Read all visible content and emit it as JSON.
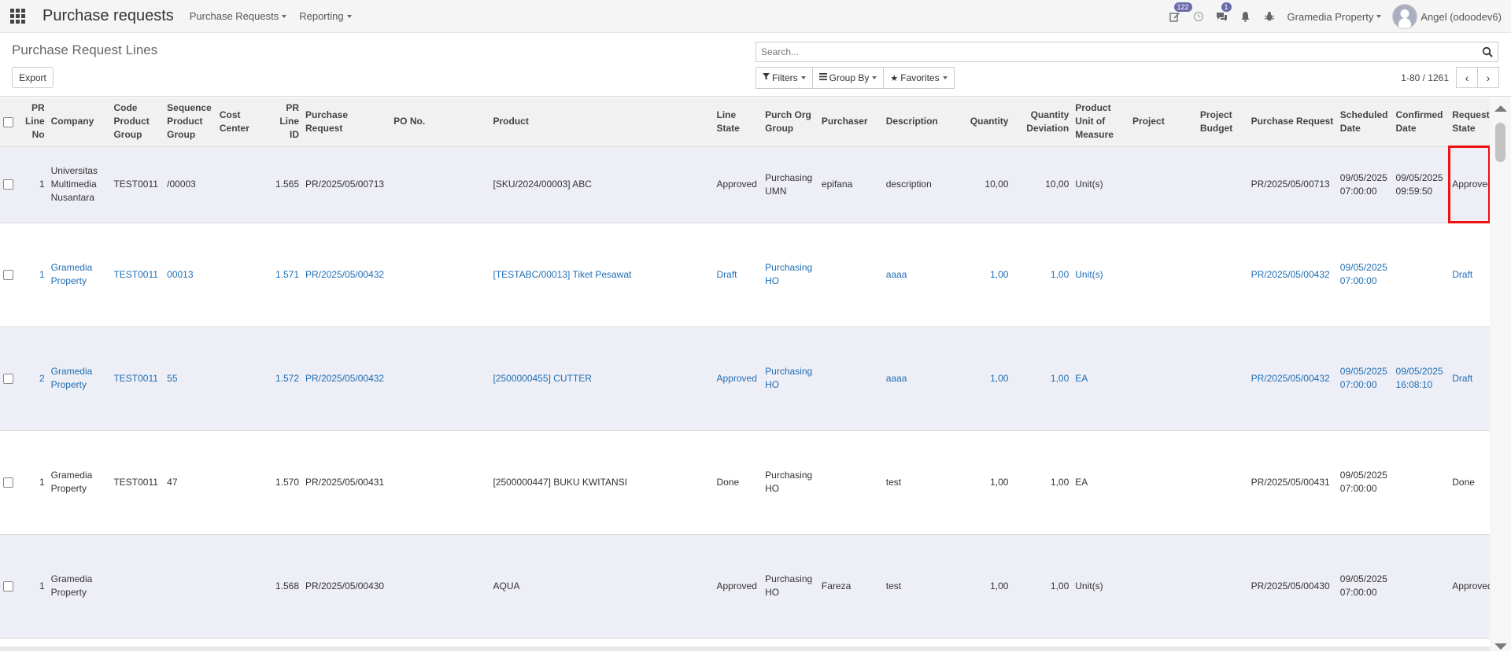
{
  "navbar": {
    "app_title": "Purchase requests",
    "menu": [
      "Purchase Requests",
      "Reporting"
    ],
    "activity_badge": "122",
    "messages_badge": "1",
    "company": "Gramedia Property",
    "user_name": "Angel (odoodev6)"
  },
  "control": {
    "title": "Purchase Request Lines",
    "export_label": "Export",
    "search_placeholder": "Search...",
    "filters_label": "Filters",
    "groupby_label": "Group By",
    "favorites_label": "Favorites",
    "pager_value": "1-80 / 1261"
  },
  "table": {
    "headers": {
      "line_no": "PR Line No",
      "company": "Company",
      "code_product_group": "Code Product Group",
      "sequence_product_group": "Sequence Product Group",
      "cost_center": "Cost Center",
      "pr_line_id": "PR Line ID",
      "purchase_request": "Purchase Request",
      "po_no": "PO No.",
      "product": "Product",
      "line_state": "Line State",
      "purch_org_group": "Purch Org Group",
      "purchaser": "Purchaser",
      "description": "Description",
      "quantity": "Quantity",
      "quantity_deviation": "Quantity Deviation",
      "uom": "Product Unit of Measure",
      "project": "Project",
      "project_budget": "Project Budget",
      "purchase_request_2": "Purchase Request",
      "scheduled_date": "Scheduled Date",
      "confirmed_date": "Confirmed Date",
      "request_state": "Request State"
    },
    "rows": [
      {
        "line_no": "1",
        "company": "Universitas Multimedia Nusantara",
        "code_product_group": "TEST0011",
        "sequence_product_group": "/00003",
        "cost_center": "",
        "pr_line_id": "1.565",
        "purchase_request": "PR/2025/05/00713",
        "po_no": "",
        "product": "[SKU/2024/00003] ABC",
        "line_state": "Approved",
        "purch_org_group": "Purchasing UMN",
        "purchaser": "epifana",
        "description": "description",
        "quantity": "10,00",
        "quantity_deviation": "10,00",
        "uom": "Unit(s)",
        "project": "",
        "project_budget": "",
        "purchase_request_2": "PR/2025/05/00713",
        "scheduled_date": "09/05/2025 07:00:00",
        "confirmed_date": "09/05/2025 09:59:50",
        "request_state": "Approved"
      },
      {
        "line_no": "1",
        "company": "Gramedia Property",
        "code_product_group": "TEST0011",
        "sequence_product_group": "00013",
        "cost_center": "",
        "pr_line_id": "1.571",
        "purchase_request": "PR/2025/05/00432",
        "po_no": "",
        "product": "[TESTABC/00013] Tiket Pesawat",
        "line_state": "Draft",
        "purch_org_group": "Purchasing HO",
        "purchaser": "",
        "description": "aaaa",
        "quantity": "1,00",
        "quantity_deviation": "1,00",
        "uom": "Unit(s)",
        "project": "",
        "project_budget": "",
        "purchase_request_2": "PR/2025/05/00432",
        "scheduled_date": "09/05/2025 07:00:00",
        "confirmed_date": "",
        "request_state": "Draft"
      },
      {
        "line_no": "2",
        "company": "Gramedia Property",
        "code_product_group": "TEST0011",
        "sequence_product_group": "55",
        "cost_center": "",
        "pr_line_id": "1.572",
        "purchase_request": "PR/2025/05/00432",
        "po_no": "",
        "product": "[2500000455] CUTTER",
        "line_state": "Approved",
        "purch_org_group": "Purchasing HO",
        "purchaser": "",
        "description": "aaaa",
        "quantity": "1,00",
        "quantity_deviation": "1,00",
        "uom": "EA",
        "project": "",
        "project_budget": "",
        "purchase_request_2": "PR/2025/05/00432",
        "scheduled_date": "09/05/2025 07:00:00",
        "confirmed_date": "09/05/2025 16:08:10",
        "request_state": "Draft"
      },
      {
        "line_no": "1",
        "company": "Gramedia Property",
        "code_product_group": "TEST0011",
        "sequence_product_group": "47",
        "cost_center": "",
        "pr_line_id": "1.570",
        "purchase_request": "PR/2025/05/00431",
        "po_no": "",
        "product": "[2500000447] BUKU KWITANSI",
        "line_state": "Done",
        "purch_org_group": "Purchasing HO",
        "purchaser": "",
        "description": "test",
        "quantity": "1,00",
        "quantity_deviation": "1,00",
        "uom": "EA",
        "project": "",
        "project_budget": "",
        "purchase_request_2": "PR/2025/05/00431",
        "scheduled_date": "09/05/2025 07:00:00",
        "confirmed_date": "",
        "request_state": "Done"
      },
      {
        "line_no": "1",
        "company": "Gramedia Property",
        "code_product_group": "",
        "sequence_product_group": "",
        "cost_center": "",
        "pr_line_id": "1.568",
        "purchase_request": "PR/2025/05/00430",
        "po_no": "",
        "product": "AQUA",
        "line_state": "Approved",
        "purch_org_group": "Purchasing HO",
        "purchaser": "Fareza",
        "description": "test",
        "quantity": "1,00",
        "quantity_deviation": "1,00",
        "uom": "Unit(s)",
        "project": "",
        "project_budget": "",
        "purchase_request_2": "PR/2025/05/00430",
        "scheduled_date": "09/05/2025 07:00:00",
        "confirmed_date": "",
        "request_state": "Approved"
      }
    ]
  },
  "colors": {
    "link": "#1f6db4",
    "highlight_box": "#e11111",
    "row_stripe": "#eeeff6",
    "badge": "#6a6aa8"
  }
}
